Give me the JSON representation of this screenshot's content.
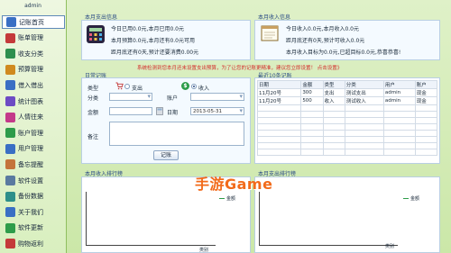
{
  "sidebar": {
    "user": "admin",
    "items": [
      {
        "label": "记账首页",
        "icon": "ledger-icon",
        "color": "#3a6fc4"
      },
      {
        "label": "账单管理",
        "icon": "bill-icon",
        "color": "#c43a3a"
      },
      {
        "label": "收支分类",
        "icon": "category-icon",
        "color": "#2e8f4e"
      },
      {
        "label": "预算管理",
        "icon": "budget-icon",
        "color": "#d08a1e"
      },
      {
        "label": "借入借出",
        "icon": "loan-icon",
        "color": "#3a6fc4"
      },
      {
        "label": "统计图表",
        "icon": "chart-icon",
        "color": "#6d4bc4"
      },
      {
        "label": "人情往来",
        "icon": "people-icon",
        "color": "#c43a8a"
      },
      {
        "label": "账户管理",
        "icon": "account-icon",
        "color": "#2e9c4a"
      },
      {
        "label": "用户管理",
        "icon": "user-icon",
        "color": "#3a6fc4"
      },
      {
        "label": "备忘提醒",
        "icon": "memo-icon",
        "color": "#c4743a"
      },
      {
        "label": "软件设置",
        "icon": "settings-icon",
        "color": "#5a7aa0"
      },
      {
        "label": "备份数据",
        "icon": "backup-icon",
        "color": "#2e8f8a"
      },
      {
        "label": "关于我们",
        "icon": "info-icon",
        "color": "#3a6fc4"
      },
      {
        "label": "软件更新",
        "icon": "update-icon",
        "color": "#2e9c4a"
      },
      {
        "label": "购物返利",
        "icon": "shopping-icon",
        "color": "#c43a3a"
      }
    ]
  },
  "expense_info": {
    "title": "本月支出信息",
    "line1": "今日已用0.0元,本月已用0.0元",
    "line2": "本月预算0.0元,本月还有0.0元可用",
    "line3": "距月底还有0天,预计还要消费0.00元"
  },
  "income_info": {
    "title": "本月收入信息",
    "line1": "今日收入0.0元,本月收入0.0元",
    "line2": "距月底还有0天,预计可收入0.0元",
    "line3": "本月收入目标为0.0元,已超目标0.0元,恭喜恭喜!"
  },
  "daily": {
    "title": "日常记账",
    "warning": "系统检测到您本月还未设置支出预算，为了让您的记账更精准，建议您立即设置！ 点击设置》",
    "type_label": "类型",
    "expense_radio": "支出",
    "income_radio": "收入",
    "category_label": "分类",
    "account_label": "账户",
    "amount_label": "金额",
    "date_label": "日期",
    "date_value": "2013-05-31",
    "note_label": "备注",
    "submit_label": "记账"
  },
  "recent": {
    "title": "最近10条记账",
    "headers": [
      "日期",
      "金额",
      "类型",
      "分类",
      "用户",
      "账户"
    ],
    "rows": [
      [
        "11月20号",
        "300",
        "支出",
        "测试支出",
        "admin",
        "现金"
      ],
      [
        "11月20号",
        "500",
        "收入",
        "测试收入",
        "admin",
        "现金"
      ]
    ]
  },
  "income_rank": {
    "title": "本月收入排行榜",
    "legend": "金额",
    "axis": "类别"
  },
  "expense_rank": {
    "title": "本月支出排行榜",
    "legend": "金额",
    "axis": "类别"
  },
  "watermark": "手游Game"
}
